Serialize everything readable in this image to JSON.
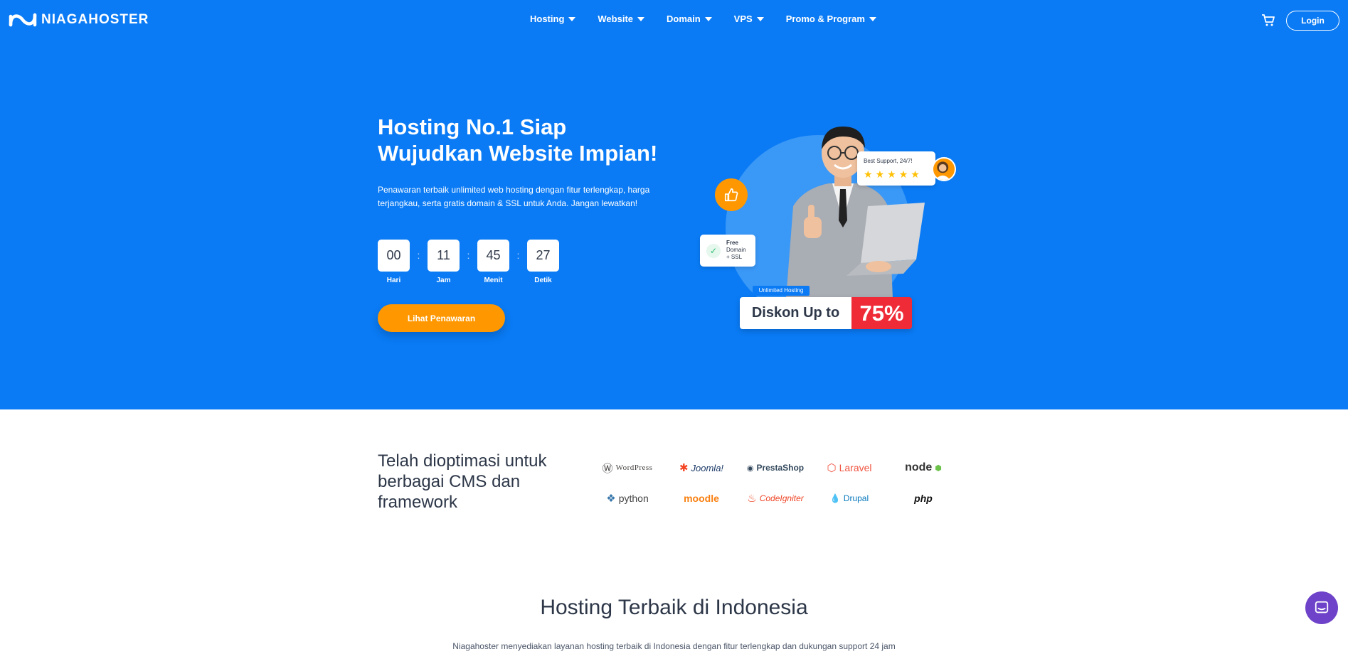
{
  "brand": {
    "name": "NIAGAHOSTER"
  },
  "nav": {
    "items": [
      {
        "label": "Hosting"
      },
      {
        "label": "Website"
      },
      {
        "label": "Domain"
      },
      {
        "label": "VPS"
      },
      {
        "label": "Promo & Program"
      }
    ],
    "login_label": "Login",
    "cart_icon": "cart-icon"
  },
  "hero": {
    "title": "Hosting No.1 Siap Wujudkan Website Impian!",
    "description": "Penawaran terbaik unlimited web hosting dengan fitur terlengkap, harga terjangkau, serta gratis domain & SSL untuk Anda. Jangan lewatkan!",
    "countdown": [
      {
        "value": "00",
        "label": "Hari"
      },
      {
        "value": "11",
        "label": "Jam"
      },
      {
        "value": "45",
        "label": "Menit"
      },
      {
        "value": "27",
        "label": "Detik"
      }
    ],
    "separator": ":",
    "cta_label": "Lihat Penawaran"
  },
  "illustration": {
    "review_text": "Best Support, 24/7!",
    "stars": 5,
    "free_line1": "Free",
    "free_line2": "Domain",
    "free_line3": "+ SSL",
    "unlimited_tag": "Unlimited Hosting",
    "discount_label": "Diskon Up to",
    "discount_value": "75%"
  },
  "cms": {
    "title": "Telah dioptimasi untuk berbagai CMS dan framework",
    "row1": [
      "WordPress",
      "Joomla!",
      "PrestaShop",
      "Laravel",
      "node"
    ],
    "row2": [
      "python",
      "moodle",
      "CodeIgniter",
      "Drupal",
      "php"
    ]
  },
  "section": {
    "title": "Hosting Terbaik di Indonesia",
    "description": "Niagahoster menyediakan layanan hosting terbaik di Indonesia dengan fitur terlengkap dan dukungan support 24 jam"
  },
  "colors": {
    "hero_bg": "#0a7bf5",
    "cta": "#ff9800",
    "discount_red": "#ef2b38",
    "chat": "#6e43c9"
  }
}
